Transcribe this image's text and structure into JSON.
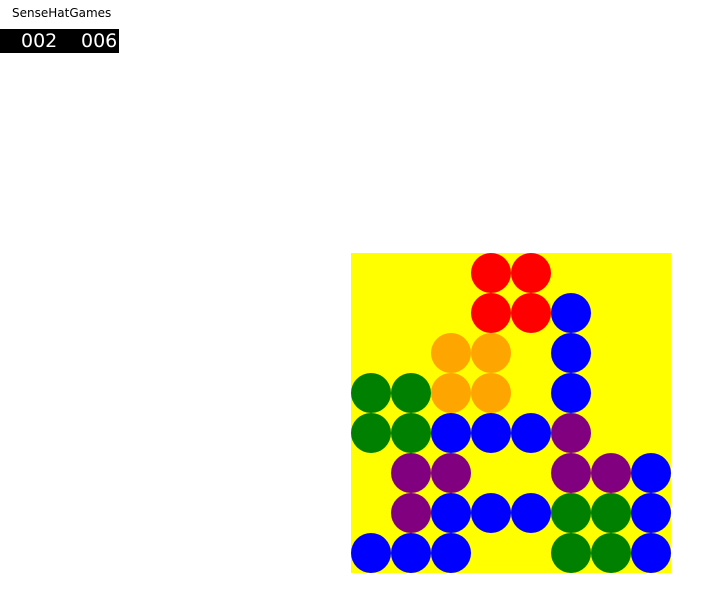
{
  "app": {
    "title": "SenseHatGames"
  },
  "scores": {
    "left": "002",
    "right": "006"
  },
  "board": {
    "background": "#ffff00",
    "rows": 8,
    "cols": 8,
    "palette": {
      "R": "#ff0000",
      "O": "#ffa500",
      "B": "#0000ff",
      "G": "#008000",
      "P": "#800080"
    },
    "grid": [
      "...RR...",
      "...RRB..",
      "..OO.B..",
      "GGOO.B..",
      "GGBBBP..",
      ".PP..PPB",
      ".PBBBGGB",
      "BBB..GGB"
    ]
  }
}
